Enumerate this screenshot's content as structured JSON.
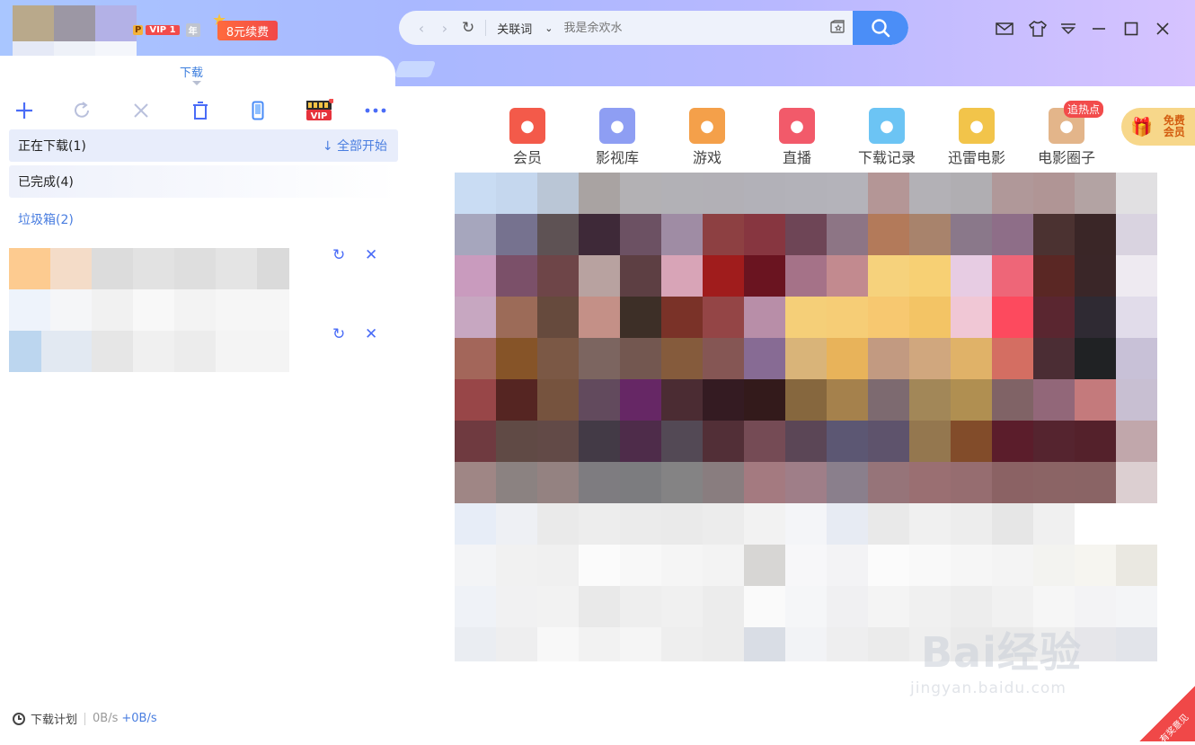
{
  "header": {
    "vip_p": "P",
    "vip_label": "VIP 1",
    "vip_year": "年",
    "renew_label": "8元续费"
  },
  "search": {
    "keyword_label": "关联词",
    "placeholder": "我是余欢水"
  },
  "tabs": {
    "active_label": "下载"
  },
  "categories": {
    "downloading": "正在下载(1)",
    "start_all": "全部开始",
    "completed": "已完成(4)",
    "trash": "垃圾箱(2)"
  },
  "home_icons": [
    {
      "label": "会员",
      "color": "#f35a4a",
      "icon": "heart-v-icon"
    },
    {
      "label": "影视库",
      "color": "#8e9ef3",
      "icon": "film-icon"
    },
    {
      "label": "游戏",
      "color": "#f4a04a",
      "icon": "gamepad-icon"
    },
    {
      "label": "直播",
      "color": "#f25a6a",
      "icon": "tv-icon"
    },
    {
      "label": "下载记录",
      "color": "#6cc4f4",
      "icon": "cloud-icon"
    },
    {
      "label": "迅雷电影",
      "color": "#f2c44a",
      "icon": "bird-icon"
    },
    {
      "label": "电影圈子",
      "color": "#e3b58a",
      "icon": "circle-icon"
    }
  ],
  "hot_badge": "追热点",
  "free_member": {
    "line1": "免费",
    "line2": "会员"
  },
  "status": {
    "plan_label": "下载计划",
    "down_speed": "0B/s",
    "up_speed": "+0B/s"
  },
  "watermark": {
    "brand": "Bai经验",
    "url": "jingyan.baidu.com"
  },
  "corner_badge": "有奖意见"
}
